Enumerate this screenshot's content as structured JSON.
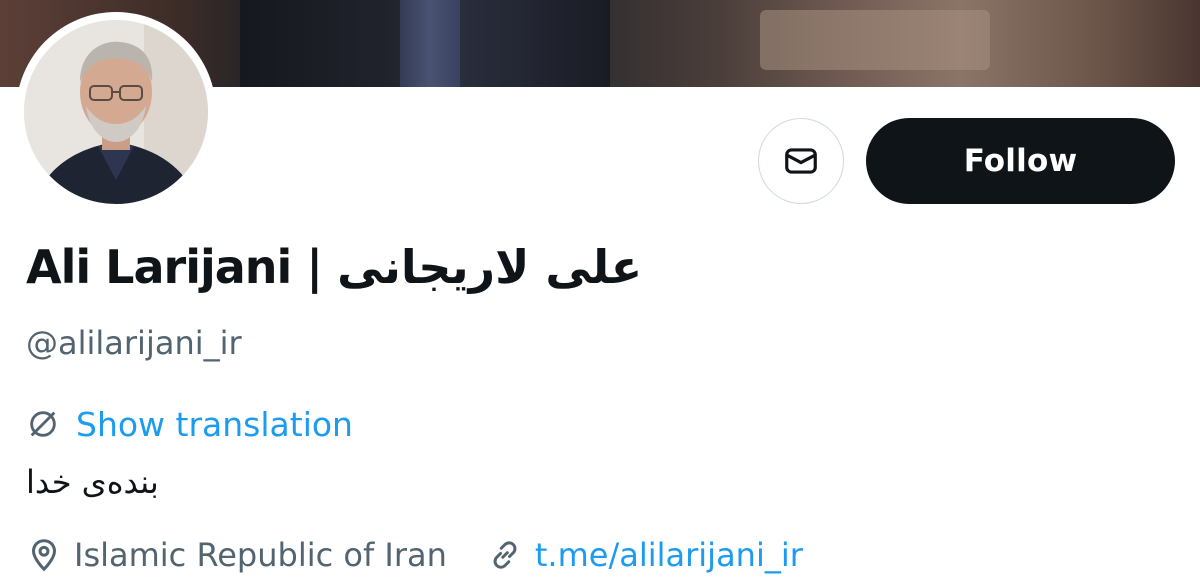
{
  "profile": {
    "display_name": "Ali Larijani | علی لاریجانی",
    "handle": "@alilarijani_ir",
    "bio": "بنده‌ی خدا",
    "location": "Islamic Republic of Iran",
    "link": "t.me/alilarijani_ir"
  },
  "actions": {
    "follow_label": "Follow",
    "message_icon": "envelope-icon"
  },
  "translation": {
    "label": "Show translation",
    "icon": "translate-globe-icon"
  },
  "icons": {
    "location": "location-pin-icon",
    "link": "link-chain-icon"
  },
  "colors": {
    "text_primary": "#0f1419",
    "text_secondary": "#536471",
    "accent_blue": "#1d9bf0",
    "follow_button_bg": "#0f1419",
    "border": "#cfd9de"
  }
}
